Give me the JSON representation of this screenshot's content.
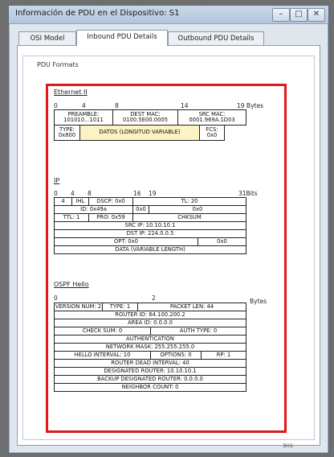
{
  "window": {
    "title": "Información de PDU en el Dispositivo: S1"
  },
  "tabs": [
    {
      "label": "OSI Model"
    },
    {
      "label": "Inbound PDU Details"
    },
    {
      "label": "Outbound PDU Details"
    }
  ],
  "pdu": {
    "legend": "PDU Formats",
    "ethernet": {
      "title": "Ethernet II",
      "ruler": {
        "a": "0",
        "b": "4",
        "c": "8",
        "d": "14",
        "e": "19 Bytes"
      },
      "preamble": "PREAMBLE:\n101010...1011",
      "dest_mac": "DEST MAC:\n0100.5E00.0005",
      "src_mac": "SRC MAC:\n0001.969A.1D03",
      "type": "TYPE:\n0x800",
      "data": "DATOS (LONGITUD VARIABLE)",
      "fcs": "FCS:\n0x0"
    },
    "ip": {
      "title": "IP",
      "ruler": {
        "a": "0",
        "b": "4",
        "c": "8",
        "d": "16",
        "e": "19",
        "f": "31Bits"
      },
      "version": "4",
      "ihl": "IHL",
      "dscp": "DSCP: 0x0",
      "tl": "TL: 20",
      "id": "ID: 0x49a",
      "flags": "0x0",
      "frag": "0x0",
      "ttl": "TTL: 1",
      "pro": "PRO: 0x59",
      "chksum": "CHKSUM",
      "src": "SRC IP: 10.10.10.1",
      "dst": "DST IP: 224.0.0.5",
      "opt": "OPT: 0x0",
      "pad": "0x0",
      "data": "DATA (VARIABLE LENGTH)"
    },
    "ospf": {
      "title": "OSPF Hello",
      "ruler": {
        "a": "0",
        "b": "2",
        "e": "Bytes"
      },
      "version": "VERSION NUM: 2",
      "type": "TYPE: 1",
      "packet_len": "PACKET LEN: 44",
      "router_id": "ROUTER ID: 64.100.200.2",
      "area_id": "AREA ID: 0.0.0.0",
      "checksum": "CHECK SUM: 0",
      "auth_type": "AUTH TYPE: 0",
      "authentication": "AUTHENTICATION",
      "netmask": "NETWORK MASK: 255.255.255.0",
      "hello_interval": "HELLO INTERVAL: 10",
      "options": "OPTIONS: 0",
      "rp": "RP: 1",
      "dead_interval": "ROUTER DEAD INTERVAL: 40",
      "dr": "DESIGNATED ROUTER: 10.10.10.1",
      "bdr": "BACKUP DESIGNATED ROUTER: 0.0.0.0",
      "neighbor_count": "NEIGHBOR COUNT: 0"
    }
  },
  "status": {
    "text": "3H1"
  }
}
